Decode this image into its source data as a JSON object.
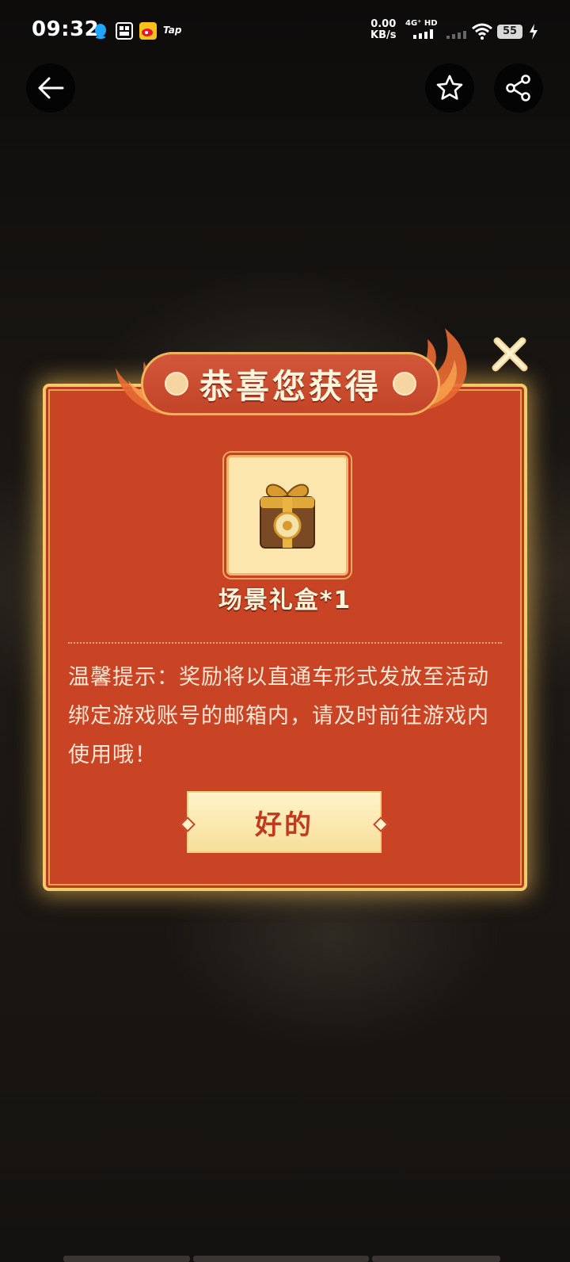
{
  "status_bar": {
    "time": "09:32",
    "net_speed_value": "0.00",
    "net_speed_unit": "KB/s",
    "network_type": "4G⁺ HD",
    "battery": "55",
    "app_icons": [
      "qq-icon",
      "game-hall-icon",
      "weibo-icon",
      "tap-icon"
    ],
    "tap_label": "Tap"
  },
  "nav": {
    "back_icon": "arrow-left-icon",
    "favorite_icon": "star-icon",
    "share_icon": "share-icon"
  },
  "modal": {
    "title": "恭喜您获得",
    "reward_name": "场景礼盒*1",
    "tip_line1": "温馨提示：奖励将以直通车形式发放至活动",
    "tip_line2": "绑定游戏账号的邮箱内，请及时前往游戏内",
    "tip_line3": "使用哦！",
    "ok_label": "好的"
  },
  "colors": {
    "modal_red": "#c84425",
    "gold_border": "#f3c96a",
    "button_cream": "#fff3c9",
    "button_text": "#c23a1e"
  }
}
